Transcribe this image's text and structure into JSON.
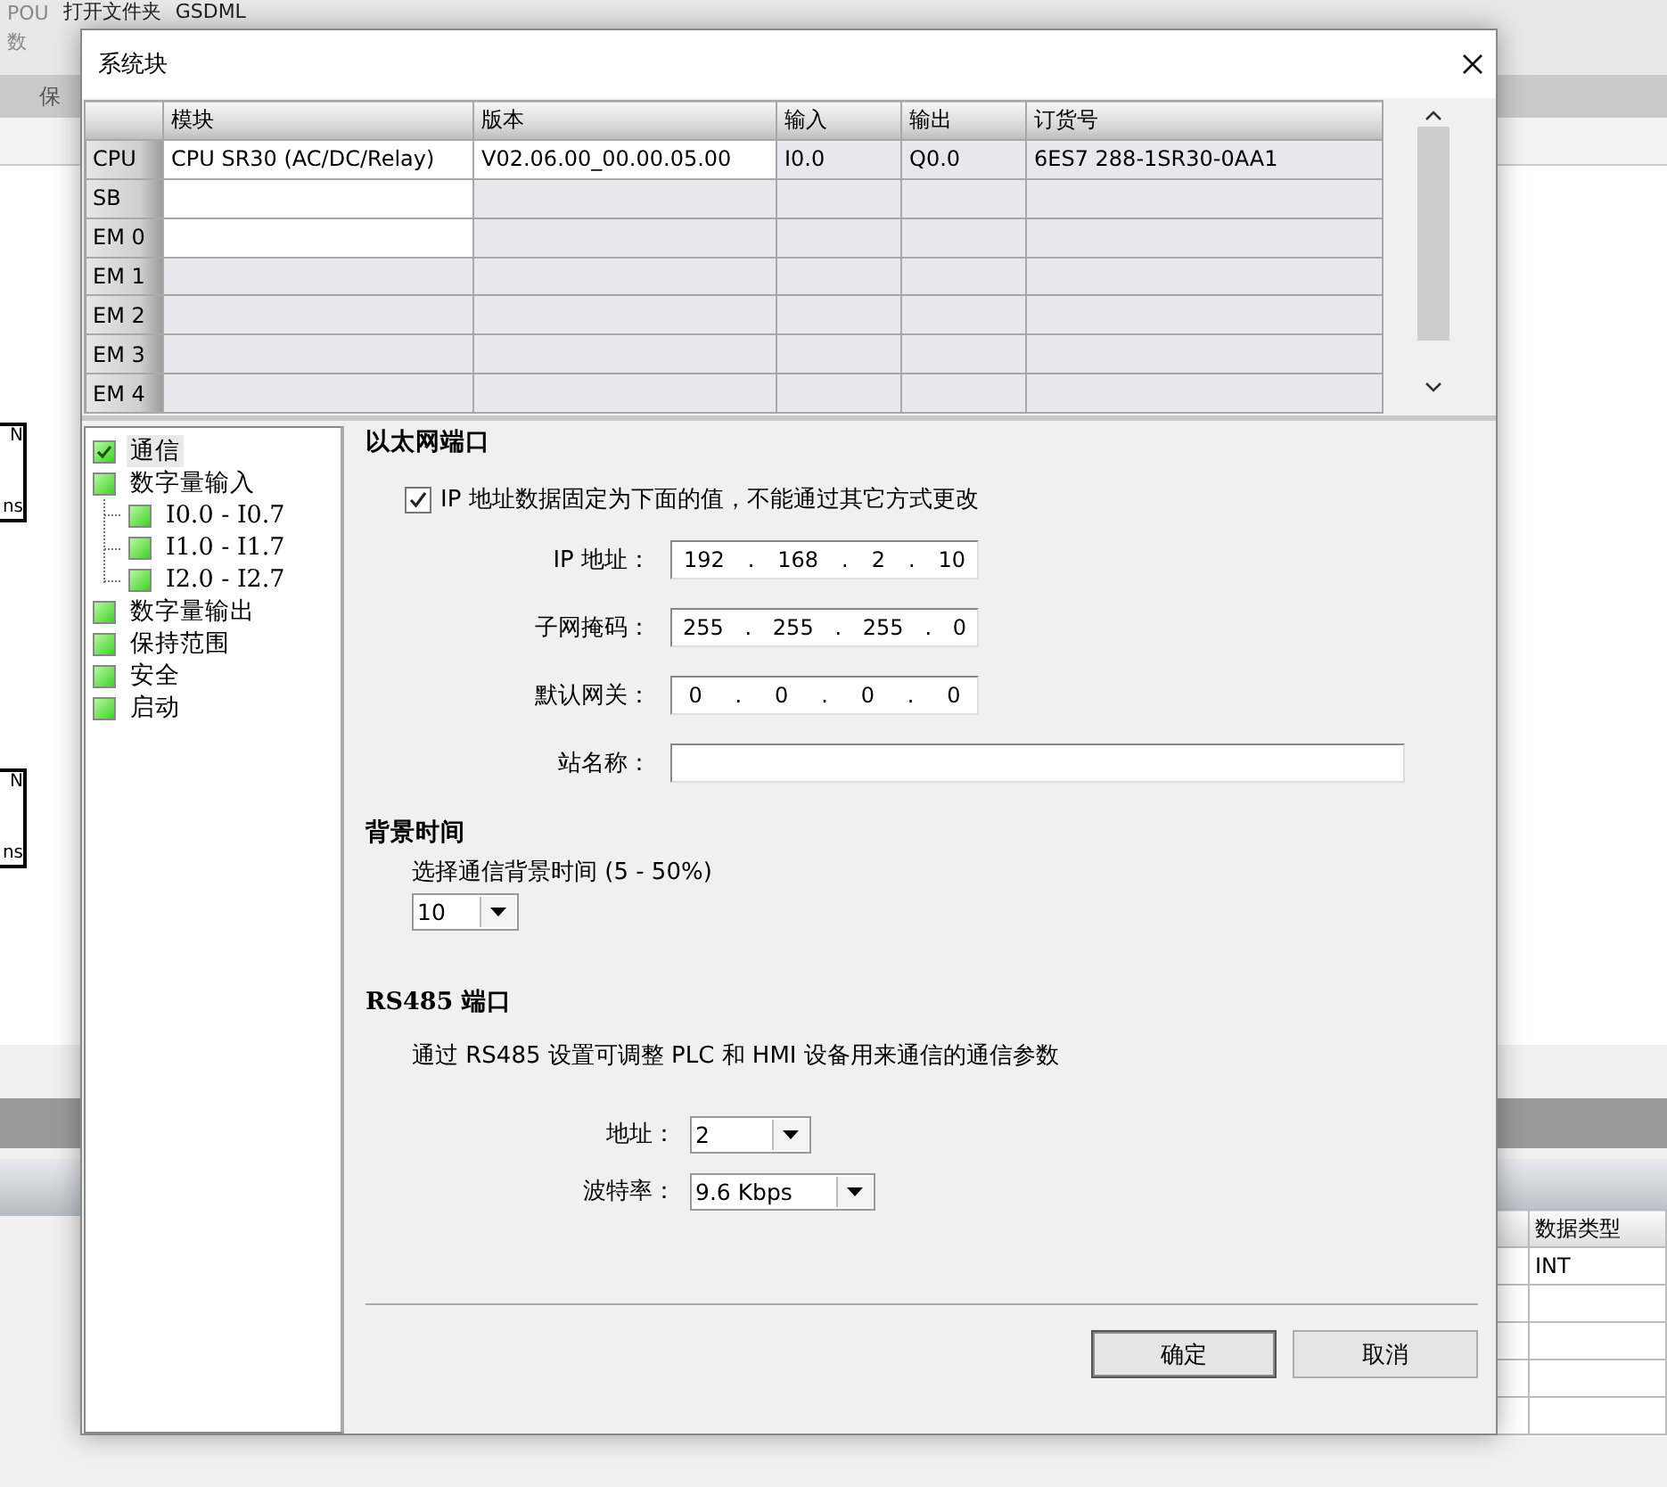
{
  "background": {
    "toolbar_items": [
      {
        "label": "POU"
      },
      {
        "label": "数"
      },
      {
        "label": "打开文件夹"
      },
      {
        "label": "GSDML"
      }
    ],
    "group_label": "保",
    "ladder_fragments": [
      {
        "top": "N",
        "bottom": "ns"
      },
      {
        "top": "N",
        "bottom": "ns"
      }
    ],
    "table": {
      "columns": [
        "数据类型"
      ],
      "rows": [
        [
          "INT"
        ]
      ]
    }
  },
  "dialog": {
    "title": "系统块",
    "modules_table": {
      "columns": [
        "模块",
        "版本",
        "输入",
        "输出",
        "订货号"
      ],
      "rows": [
        {
          "slot": "CPU",
          "cells": [
            {
              "text": "CPU SR30 (AC/DC/Relay)",
              "editable": true
            },
            {
              "text": "V02.06.00_00.00.05.00",
              "editable": true
            },
            {
              "text": "I0.0",
              "editable": false
            },
            {
              "text": "Q0.0",
              "editable": false
            },
            {
              "text": "6ES7 288-1SR30-0AA1",
              "editable": false
            }
          ]
        },
        {
          "slot": "SB",
          "cells": [
            {
              "editable": true
            },
            {
              "editable": false
            },
            {
              "editable": false
            },
            {
              "editable": false
            },
            {
              "editable": false
            }
          ]
        },
        {
          "slot": "EM 0",
          "cells": [
            {
              "editable": true
            },
            {
              "editable": false
            },
            {
              "editable": false
            },
            {
              "editable": false
            },
            {
              "editable": false
            }
          ]
        },
        {
          "slot": "EM 1",
          "cells": [
            {
              "editable": false
            },
            {
              "editable": false
            },
            {
              "editable": false
            },
            {
              "editable": false
            },
            {
              "editable": false
            }
          ]
        },
        {
          "slot": "EM 2",
          "cells": [
            {
              "editable": false
            },
            {
              "editable": false
            },
            {
              "editable": false
            },
            {
              "editable": false
            },
            {
              "editable": false
            }
          ]
        },
        {
          "slot": "EM 3",
          "cells": [
            {
              "editable": false
            },
            {
              "editable": false
            },
            {
              "editable": false
            },
            {
              "editable": false
            },
            {
              "editable": false
            }
          ]
        },
        {
          "slot": "EM 4",
          "cells": [
            {
              "editable": false
            },
            {
              "editable": false
            },
            {
              "editable": false
            },
            {
              "editable": false
            },
            {
              "editable": false
            }
          ]
        }
      ]
    },
    "tree": [
      {
        "label": "通信",
        "checked": true,
        "selected": true
      },
      {
        "label": "数字量输入",
        "checked": false,
        "selected": false,
        "children": [
          {
            "label": "I0.0 - I0.7",
            "checked": false,
            "selected": false
          },
          {
            "label": "I1.0 - I1.7",
            "checked": false,
            "selected": false
          },
          {
            "label": "I2.0 - I2.7",
            "checked": false,
            "selected": false
          }
        ]
      },
      {
        "label": "数字量输出",
        "checked": false,
        "selected": false
      },
      {
        "label": "保持范围",
        "checked": false,
        "selected": false
      },
      {
        "label": "安全",
        "checked": false,
        "selected": false
      },
      {
        "label": "启动",
        "checked": false,
        "selected": false
      }
    ],
    "ethernet": {
      "heading": "以太网端口",
      "fixed_ip": {
        "label": "IP 地址数据固定为下面的值，不能通过其它方式更改",
        "checked": true
      },
      "ip_fields": [
        {
          "label": "IP 地址：",
          "octets": [
            "192",
            "168",
            "2",
            "10"
          ],
          "separator": "."
        },
        {
          "label": "子网掩码：",
          "octets": [
            "255",
            "255",
            "255",
            "0"
          ],
          "separator": "."
        },
        {
          "label": "默认网关：",
          "octets": [
            "0",
            "0",
            "0",
            "0"
          ],
          "separator": "."
        }
      ],
      "station_name": {
        "label": "站名称："
      }
    },
    "background_time": {
      "heading": "背景时间",
      "label": "选择通信背景时间 (5 - 50%)",
      "value": "10"
    },
    "rs485": {
      "heading": "RS485 端口",
      "description": "通过 RS485 设置可调整 PLC 和 HMI 设备用来通信的通信参数",
      "fields": [
        {
          "label": "地址：",
          "value": "2"
        },
        {
          "label": "波特率：",
          "value": "9.6 Kbps"
        }
      ]
    },
    "buttons": [
      {
        "label": "确定",
        "default": true
      },
      {
        "label": "取消",
        "default": false
      }
    ]
  }
}
